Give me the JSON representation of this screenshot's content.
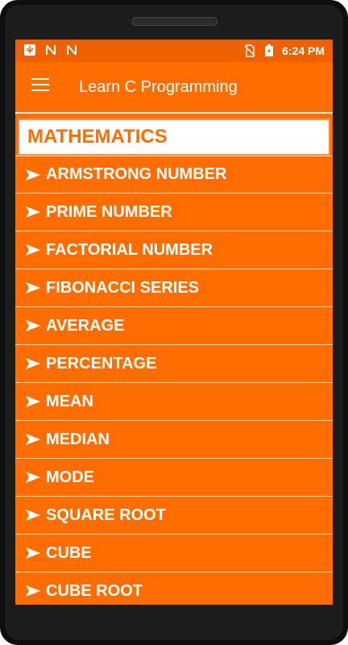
{
  "status_bar": {
    "time": "6:24 PM",
    "left_icons": [
      "usb-icon",
      "notification-n-icon",
      "notification-n-icon"
    ],
    "right_icons": [
      "no-sim-icon",
      "battery-charging-icon"
    ]
  },
  "app_bar": {
    "title": "Learn C Programming",
    "menu_icon": "hamburger-menu-icon"
  },
  "section": {
    "title": "MATHEMATICS"
  },
  "items": [
    {
      "label": "ARMSTRONG NUMBER"
    },
    {
      "label": "PRIME NUMBER"
    },
    {
      "label": "FACTORIAL NUMBER"
    },
    {
      "label": "FIBONACCI SERIES"
    },
    {
      "label": "AVERAGE"
    },
    {
      "label": "PERCENTAGE"
    },
    {
      "label": "MEAN"
    },
    {
      "label": "MEDIAN"
    },
    {
      "label": "MODE"
    },
    {
      "label": "SQUARE ROOT"
    },
    {
      "label": "CUBE"
    },
    {
      "label": "CUBE ROOT"
    }
  ],
  "colors": {
    "accent": "#ff6d00",
    "status_bar": "#ee6100",
    "text_on_accent": "#ffffff"
  }
}
